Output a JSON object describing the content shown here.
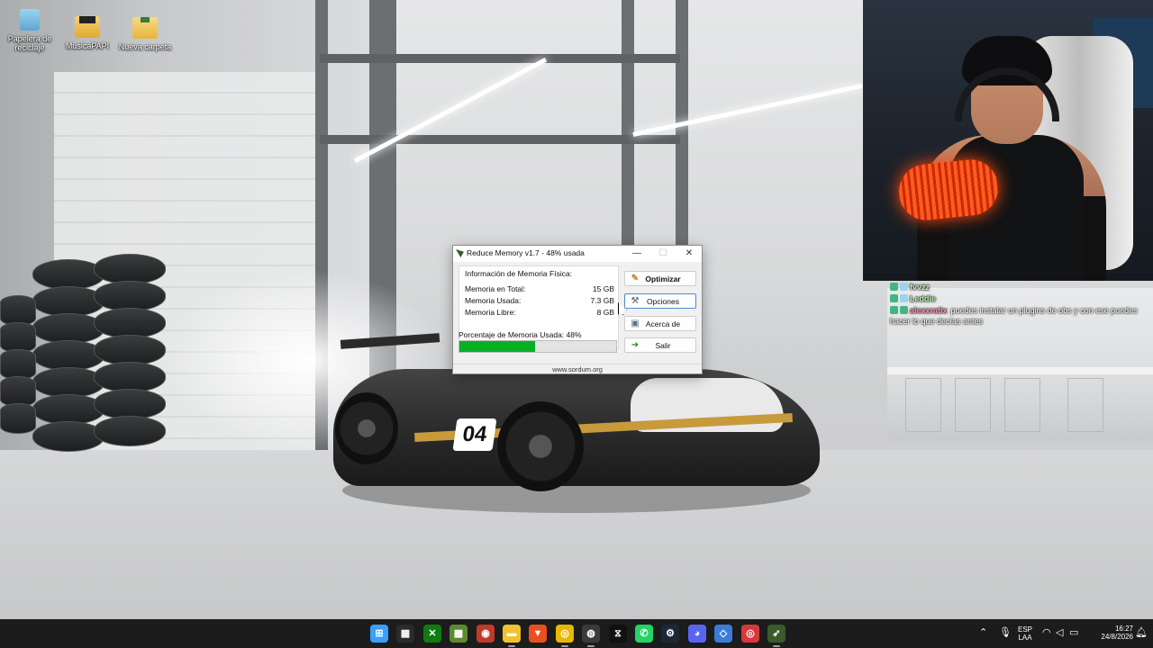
{
  "desktop": {
    "icons": [
      {
        "label": "Papelera de reciclaje",
        "icon": "recycle-bin-icon"
      },
      {
        "label": "MusicaPAPI",
        "icon": "folder-icon"
      },
      {
        "label": "Nueva carpeta",
        "icon": "folder-icon"
      }
    ],
    "wallpaper_number": "04"
  },
  "reduce_memory": {
    "title": "Reduce Memory v1.7 - 48% usada",
    "group_title": "Información de Memoria Física:",
    "rows": [
      {
        "label": "Memoria en Total:",
        "value": "15 GB"
      },
      {
        "label": "Memoria Usada:",
        "value": "7.3 GB"
      },
      {
        "label": "Memoria Libre:",
        "value": "8 GB"
      }
    ],
    "usage_label": "Porcentaje de Memoria Usada: 48%",
    "usage_fraction": 0.48,
    "buttons": {
      "optimize": "Optimizar",
      "options": "Opciones",
      "about": "Acerca de",
      "exit": "Salir"
    },
    "footer": "www.sordum.org",
    "controls": {
      "minimize": "—",
      "maximize": "☐",
      "close": "✕"
    }
  },
  "chat": {
    "messages": [
      {
        "user": "fvvzz",
        "text": "",
        "user_color": "#b8f0b0"
      },
      {
        "user": "Leddie",
        "text": "",
        "user_color": "#b8f0b0"
      },
      {
        "user": "alexxratix",
        "text": "puedes instalar un plugins de obs y con ese puedes",
        "user_color": "#ff8fb0"
      }
    ],
    "continuation": "hacer lo que decías antes"
  },
  "taskbar": {
    "apps": [
      {
        "name": "start-icon",
        "glyph": "⊞",
        "color": "#3aa0ff"
      },
      {
        "name": "store-icon",
        "glyph": "▦",
        "color": "#2b2b2b"
      },
      {
        "name": "xbox-icon",
        "glyph": "✕",
        "color": "#107c10"
      },
      {
        "name": "minecraft-icon",
        "glyph": "▩",
        "color": "#5b8a2f"
      },
      {
        "name": "among-us-icon",
        "glyph": "◉",
        "color": "#c0392b"
      },
      {
        "name": "file-explorer-icon",
        "glyph": "▬",
        "color": "#f2c12e"
      },
      {
        "name": "brave-icon",
        "glyph": "▼",
        "color": "#e8501f"
      },
      {
        "name": "chrome-icon",
        "glyph": "◎",
        "color": "#e8b800"
      },
      {
        "name": "obs-icon",
        "glyph": "◍",
        "color": "#3a3a3a"
      },
      {
        "name": "capcut-icon",
        "glyph": "⧖",
        "color": "#111111"
      },
      {
        "name": "whatsapp-icon",
        "glyph": "✆",
        "color": "#25d366"
      },
      {
        "name": "steam-icon",
        "glyph": "⚙",
        "color": "#1b2838"
      },
      {
        "name": "discord-icon",
        "glyph": "◕",
        "color": "#5865f2"
      },
      {
        "name": "roblox-icon",
        "glyph": "◇",
        "color": "#3d7bd9"
      },
      {
        "name": "app-red-icon",
        "glyph": "◎",
        "color": "#d9383a"
      },
      {
        "name": "reduce-memory-icon",
        "glyph": "➶",
        "color": "#3b5a2b"
      }
    ],
    "language": "ESP",
    "layout": "LAA",
    "time": "16:27",
    "date": "24/8/2026"
  }
}
